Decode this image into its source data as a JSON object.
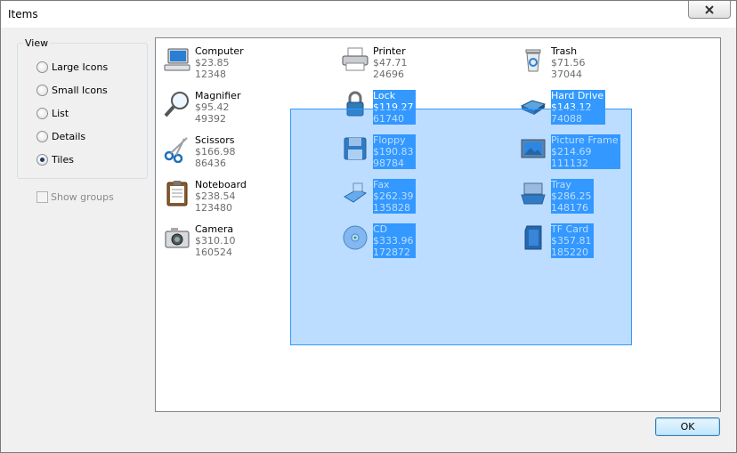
{
  "window": {
    "title": "Items"
  },
  "view_group": {
    "legend": "View",
    "options": [
      {
        "label": "Large Icons",
        "checked": false
      },
      {
        "label": "Small Icons",
        "checked": false
      },
      {
        "label": "List",
        "checked": false
      },
      {
        "label": "Details",
        "checked": false
      },
      {
        "label": "Tiles",
        "checked": true
      }
    ]
  },
  "show_groups": {
    "label": "Show groups",
    "checked": false,
    "enabled": false
  },
  "items": [
    {
      "name": "Computer",
      "price": "$23.85",
      "code": "12348",
      "icon": "computer-icon",
      "selected": false
    },
    {
      "name": "Printer",
      "price": "$47.71",
      "code": "24696",
      "icon": "printer-icon",
      "selected": false
    },
    {
      "name": "Trash",
      "price": "$71.56",
      "code": "37044",
      "icon": "trash-icon",
      "selected": false
    },
    {
      "name": "Magnifier",
      "price": "$95.42",
      "code": "49392",
      "icon": "magnifier-icon",
      "selected": false
    },
    {
      "name": "Lock",
      "price": "$119.27",
      "code": "61740",
      "icon": "lock-icon",
      "selected": true
    },
    {
      "name": "Hard Drive",
      "price": "$143.12",
      "code": "74088",
      "icon": "hard-drive-icon",
      "selected": true
    },
    {
      "name": "Scissors",
      "price": "$166.98",
      "code": "86436",
      "icon": "scissors-icon",
      "selected": false
    },
    {
      "name": "Floppy",
      "price": "$190.83",
      "code": "98784",
      "icon": "floppy-icon",
      "selected": true
    },
    {
      "name": "Picture Frame",
      "price": "$214.69",
      "code": "111132",
      "icon": "picture-frame-icon",
      "selected": true
    },
    {
      "name": "Noteboard",
      "price": "$238.54",
      "code": "123480",
      "icon": "noteboard-icon",
      "selected": false
    },
    {
      "name": "Fax",
      "price": "$262.39",
      "code": "135828",
      "icon": "fax-icon",
      "selected": true
    },
    {
      "name": "Tray",
      "price": "$286.25",
      "code": "148176",
      "icon": "tray-icon",
      "selected": true
    },
    {
      "name": "Camera",
      "price": "$310.10",
      "code": "160524",
      "icon": "camera-icon",
      "selected": false
    },
    {
      "name": "CD",
      "price": "$333.96",
      "code": "172872",
      "icon": "cd-icon",
      "selected": true
    },
    {
      "name": "TF Card",
      "price": "$357.81",
      "code": "185220",
      "icon": "tf-card-icon",
      "selected": true
    }
  ],
  "buttons": {
    "ok": "OK"
  },
  "colors": {
    "selection": "#3399ff",
    "window_bg": "#f0f0f0"
  }
}
